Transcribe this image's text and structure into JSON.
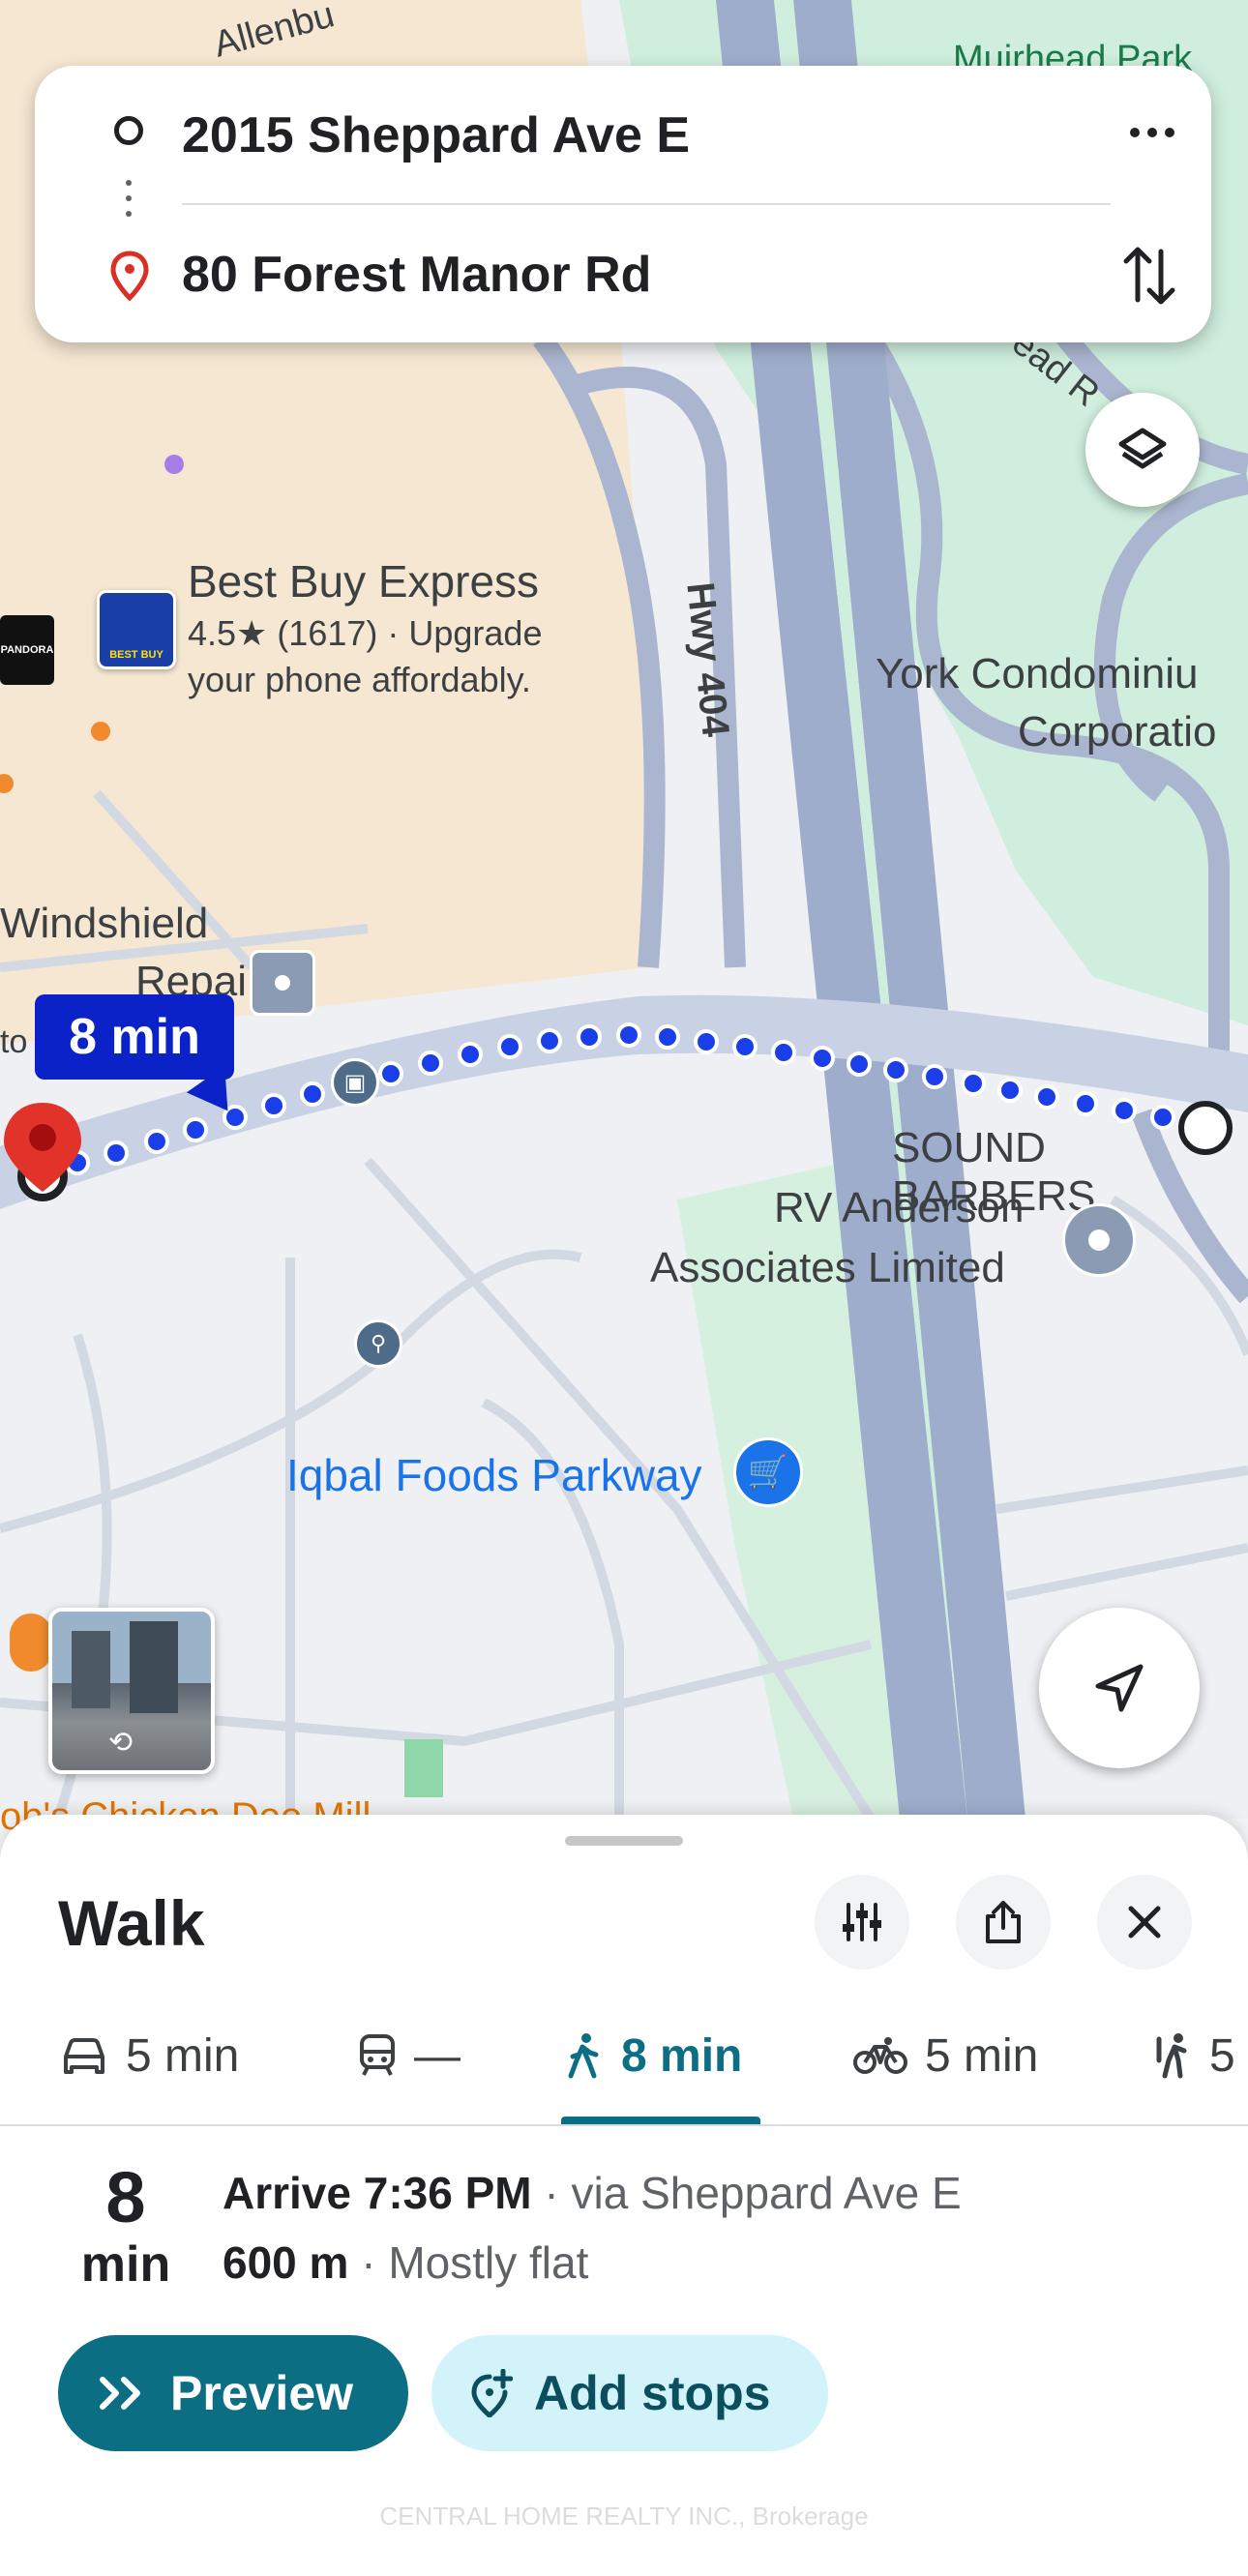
{
  "search": {
    "origin": "2015 Sheppard Ave E",
    "destination": "80 Forest Manor Rd"
  },
  "map": {
    "labels": {
      "allenbury": "Allenbu",
      "muirhead": "Muirhead Park",
      "head_rd": "ead R",
      "hwy": "Hwy 404",
      "york_line1": "York Condominiu",
      "york_line2": "Corporatio",
      "bestbuy_name": "Best Buy Express",
      "bestbuy_rating": "4.5★ (1617) · Upgrade",
      "bestbuy_desc": "your phone affordably.",
      "bestbuy_logo": "BEST BUY",
      "pandora": "PANDORA",
      "windshield_1": "Windshield",
      "windshield_2": "Repair",
      "to": "to",
      "sound_barbers": "SOUND BARBERS",
      "rv_1": "RV Anderson",
      "rv_2": "Associates Limited",
      "iqbal": "Iqbal Foods Parkway",
      "bottom_place": "ob's Chicken Dee Mill"
    },
    "route_badge": "8 min"
  },
  "sheet": {
    "title": "Walk",
    "modes": [
      {
        "icon": "car-icon",
        "label": "5 min"
      },
      {
        "icon": "transit-icon",
        "label": "—"
      },
      {
        "icon": "walk-icon",
        "label": "8 min",
        "selected": true
      },
      {
        "icon": "bike-icon",
        "label": "5 min"
      },
      {
        "icon": "ride-icon",
        "label": "5"
      }
    ],
    "duration_num": "8",
    "duration_unit": "min",
    "arrive": "Arrive 7:36 PM",
    "via": " · via Sheppard Ave E",
    "distance": "600 m",
    "terrain": " · Mostly flat",
    "preview_label": "Preview",
    "add_stops_label": "Add stops",
    "watermark": "CENTRAL HOME REALTY INC., Brokerage"
  },
  "colors": {
    "accent": "#0b6e83",
    "route": "#1a3ee8",
    "badge": "#0b22c9",
    "pin": "#d93025",
    "highway": "#9aa8c9",
    "green": "#cfeedd",
    "commercial": "#f7e8d3"
  }
}
